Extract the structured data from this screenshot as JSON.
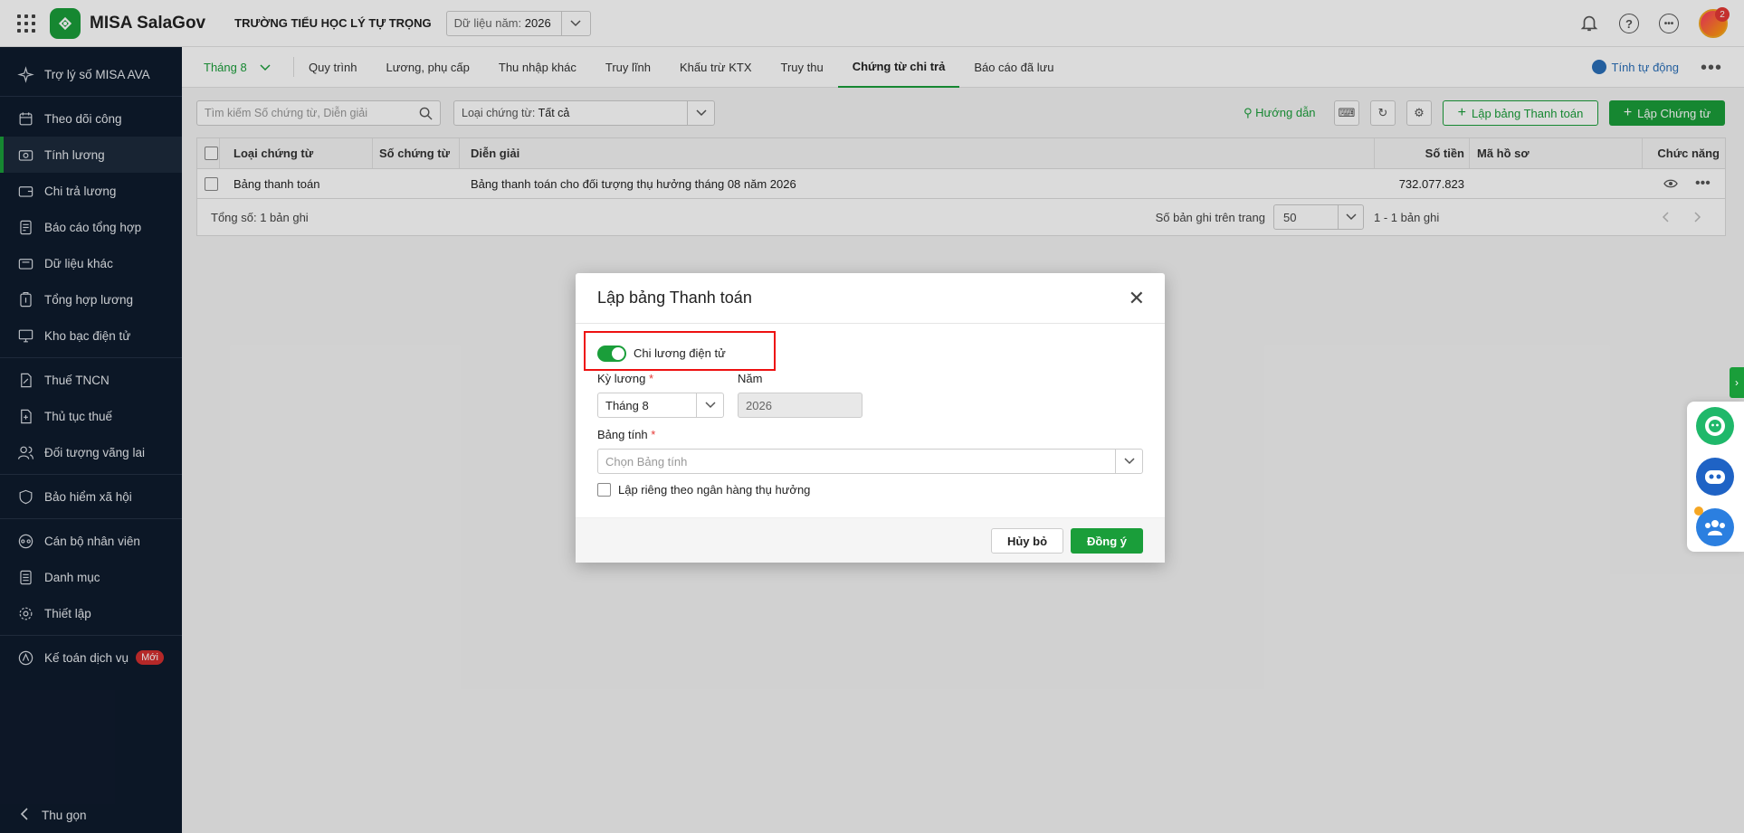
{
  "topbar": {
    "app_title": "MISA SalaGov",
    "school": "TRƯỜNG TIỂU HỌC LÝ TỰ TRỌNG",
    "year_label": "Dữ liệu năm:",
    "year_value": "2026",
    "notification_count": "2"
  },
  "sidebar": {
    "items": [
      {
        "label": "Trợ lý số MISA AVA"
      },
      {
        "label": "Theo dõi công"
      },
      {
        "label": "Tính lương"
      },
      {
        "label": "Chi trả lương"
      },
      {
        "label": "Báo cáo tổng hợp"
      },
      {
        "label": "Dữ liệu khác"
      },
      {
        "label": "Tổng hợp lương"
      },
      {
        "label": "Kho bạc điện tử"
      },
      {
        "label": "Thuế TNCN"
      },
      {
        "label": "Thủ tục thuế"
      },
      {
        "label": "Đối tượng vãng lai"
      },
      {
        "label": "Bảo hiểm xã hội"
      },
      {
        "label": "Cán bộ nhân viên"
      },
      {
        "label": "Danh mục"
      },
      {
        "label": "Thiết lập"
      },
      {
        "label": "Kế toán dịch vụ"
      }
    ],
    "new_badge": "Mới",
    "collapse": "Thu gọn"
  },
  "tabs": {
    "month": "Tháng 8",
    "items": [
      "Quy trình",
      "Lương, phụ cấp",
      "Thu nhập khác",
      "Truy lĩnh",
      "Khấu trừ KTX",
      "Truy thu",
      "Chứng từ chi trả",
      "Báo cáo đã lưu"
    ],
    "auto_calc": "Tính tự động"
  },
  "toolbar": {
    "search_placeholder": "Tìm kiếm Số chứng từ, Diễn giải",
    "doc_type_label": "Loại chứng từ:",
    "doc_type_value": "Tất cả",
    "guide": "Hướng dẫn",
    "create_payment_table": "Lập bảng Thanh toán",
    "create_voucher": "Lập Chứng từ"
  },
  "table": {
    "headers": {
      "type": "Loại chứng từ",
      "number": "Số chứng từ",
      "desc": "Diễn giải",
      "amount": "Số tiền",
      "file": "Mã hồ sơ",
      "actions": "Chức năng"
    },
    "rows": [
      {
        "type": "Bảng thanh toán",
        "number": "",
        "desc": "Bảng thanh toán cho đối tượng thụ hưởng tháng 08 năm 2026",
        "amount": "732.077.823",
        "file": ""
      }
    ],
    "total": "Tổng số: 1 bản ghi",
    "per_page_label": "Số bản ghi trên trang",
    "per_page_value": "50",
    "range": "1 - 1 bản ghi"
  },
  "dialog": {
    "title": "Lập bảng Thanh toán",
    "toggle_label": "Chi lương điện tử",
    "toggle_on": true,
    "period_label": "Kỳ lương",
    "period_value": "Tháng 8",
    "year_label": "Năm",
    "year_value": "2026",
    "sheet_label": "Bảng tính",
    "sheet_placeholder": "Chọn Bảng tính",
    "separate_bank_label": "Lập riêng theo ngân hàng thụ hưởng",
    "cancel": "Hủy bỏ",
    "ok": "Đồng ý"
  },
  "colors": {
    "brand_green": "#1a9e3a",
    "sidebar_bg": "#0f1b2d",
    "highlight_red": "#e11111"
  }
}
